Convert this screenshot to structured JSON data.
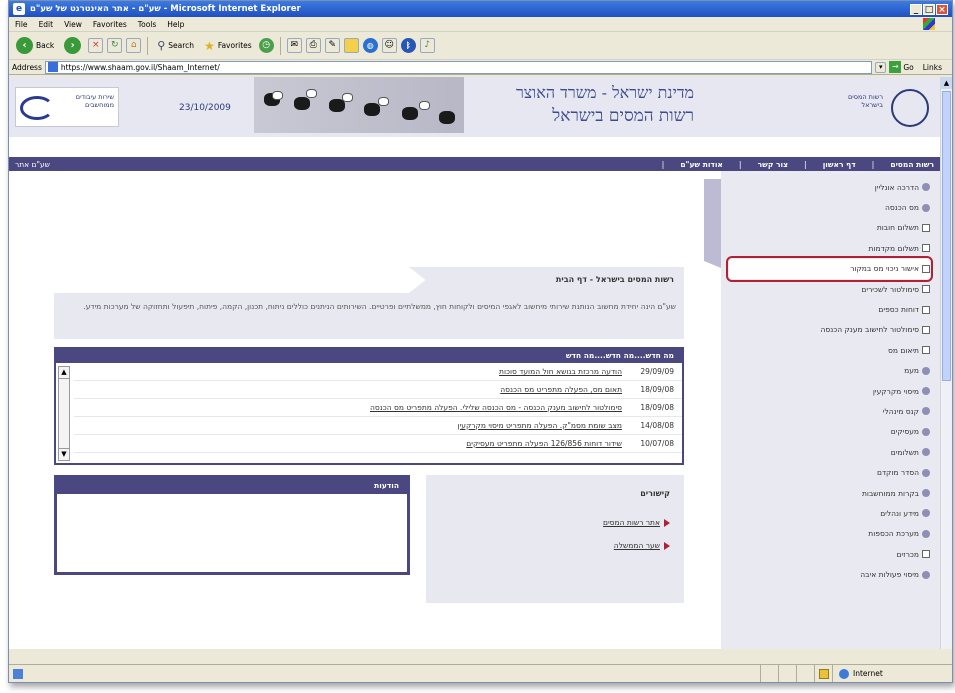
{
  "window": {
    "title": "שע\"ם - אתר האינטרנט של שע\"ם - Microsoft Internet Explorer",
    "controls": {
      "minimize": "_",
      "maximize": "□",
      "close": "×"
    }
  },
  "menu": [
    "File",
    "Edit",
    "View",
    "Favorites",
    "Tools",
    "Help"
  ],
  "toolbar": {
    "back": "Back",
    "search": "Search",
    "favorites": "Favorites"
  },
  "address": {
    "label": "Address",
    "url": "https://www.shaam.gov.il/Shaam_Internet/",
    "go": "Go",
    "links": "Links"
  },
  "status": {
    "zone": "Internet"
  },
  "site": {
    "banner": {
      "date": "23/10/2009",
      "gov_line1": "מדינת ישראל - משרד האוצר",
      "gov_line2": "רשות המסים בישראל",
      "left_logo": "שירות עיבודים ממוחשבים",
      "right_logo": "רשות המסים בישראל"
    },
    "nav": {
      "home": "רשות המסים",
      "items": [
        "דף ראשון",
        "צור קשר",
        "אודות שע\"ם"
      ],
      "english": "שע\"ם אתר"
    },
    "sidebar": {
      "items": [
        {
          "label": "הדרכה אונליין",
          "icon": "plus"
        },
        {
          "label": "מס הכנסה",
          "icon": "plus"
        },
        {
          "label": "תשלום חובות",
          "icon": "doc"
        },
        {
          "label": "תשלום מקדמות",
          "icon": "doc"
        },
        {
          "label": "אישור ניכוי מס במקור",
          "icon": "doc",
          "highlight": true
        },
        {
          "label": "סימולטור לשכירים",
          "icon": "doc"
        },
        {
          "label": "דוחות כספים",
          "icon": "doc"
        },
        {
          "label": "סימולטור לחישוב מענק הכנסה",
          "icon": "doc"
        },
        {
          "label": "תיאום מס",
          "icon": "doc"
        },
        {
          "label": "מעמ",
          "icon": "plus"
        },
        {
          "label": "מיסוי מקרקעין",
          "icon": "plus"
        },
        {
          "label": "קנס מינהלי",
          "icon": "plus"
        },
        {
          "label": "מעסיקים",
          "icon": "plus"
        },
        {
          "label": "תשלומים",
          "icon": "plus"
        },
        {
          "label": "הסדר מוקדם",
          "icon": "plus"
        },
        {
          "label": "בקרות ממוחשבות",
          "icon": "plus"
        },
        {
          "label": "מידע ונהלים",
          "icon": "plus"
        },
        {
          "label": "מערכת הכספות",
          "icon": "plus"
        },
        {
          "label": "מכרזים",
          "icon": "doc"
        },
        {
          "label": "מיסוי פעולות איבה",
          "icon": "plus"
        }
      ]
    },
    "intro": {
      "heading": "רשות המסים בישראל - דף הבית",
      "body": "שע\"ם הינה יחידת מחשוב הנותנת שירותי מיחשוב לאגפי המיסים ולקוחות חוץ, ממשלתיים ופרטיים. השירותים הניתנים כוללים ניתוח, תכנון, הקמה, פיתוח, תיפעול ותחזוקה של מערכות מידע."
    },
    "news": {
      "heading": "מה חדש....מה חדש....מה חדש",
      "rows": [
        {
          "date": "29/09/09",
          "title": "הודעה מרכזת בנושא חול המועד סוכות"
        },
        {
          "date": "18/09/08",
          "title": "תאום מס, הפעלה מתפריט מס הכנסה"
        },
        {
          "date": "18/09/08",
          "title": "סימולטור לחישוב מענק הכנסה - מס הכנסה שלילי. הפעלה מתפריט מס הכנסה"
        },
        {
          "date": "14/08/08",
          "title": "מצב שומת מסמ\"ק. הפעלה מתפריט מיסוי מקרקעין"
        },
        {
          "date": "10/07/08",
          "title": "שידור דוחות 126/856 הפעלה מתפריט מעסיקים"
        }
      ]
    },
    "links": {
      "heading": "קישורים",
      "items": [
        "אתר רשות המסים",
        "שער הממשלה"
      ]
    },
    "notices": {
      "heading": "הודעות"
    }
  }
}
